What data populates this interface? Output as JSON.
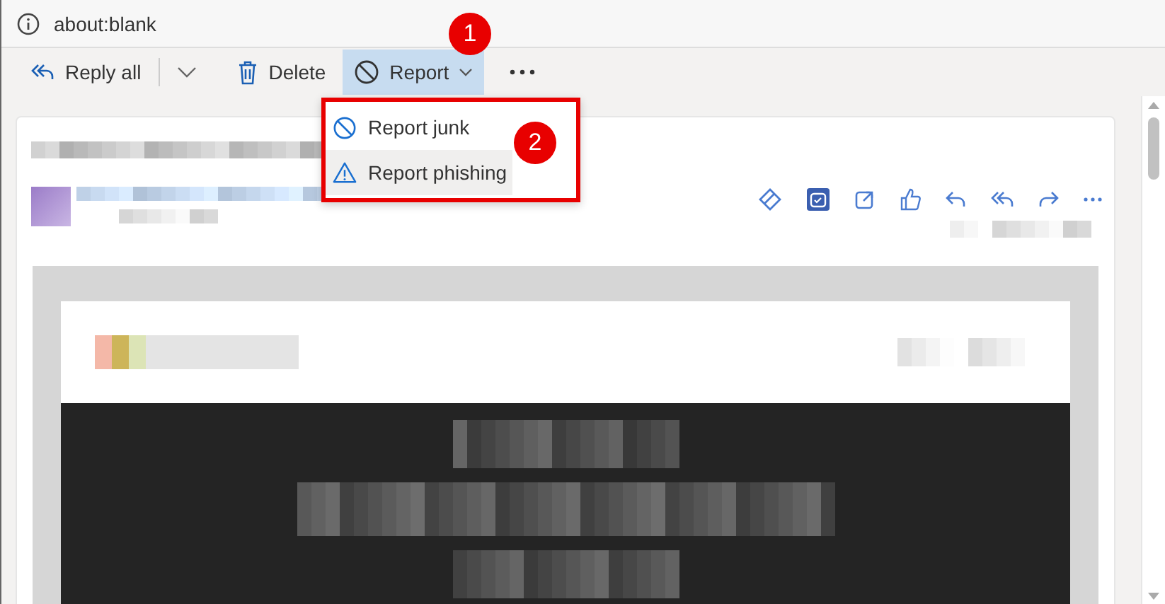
{
  "address_bar": {
    "url": "about:blank"
  },
  "toolbar": [
    {
      "kind": "reply-all",
      "label": "Reply all",
      "expanded": false
    },
    {
      "kind": "delete",
      "label": "Delete",
      "expanded": false
    },
    {
      "kind": "report",
      "label": "Report",
      "expanded": true
    }
  ],
  "report_menu": [
    {
      "kind": "junk",
      "label": "Report junk",
      "selected": false
    },
    {
      "kind": "phishing",
      "label": "Report phishing",
      "selected": true
    }
  ],
  "callouts": [
    {
      "label": "1"
    },
    {
      "label": "2"
    }
  ]
}
